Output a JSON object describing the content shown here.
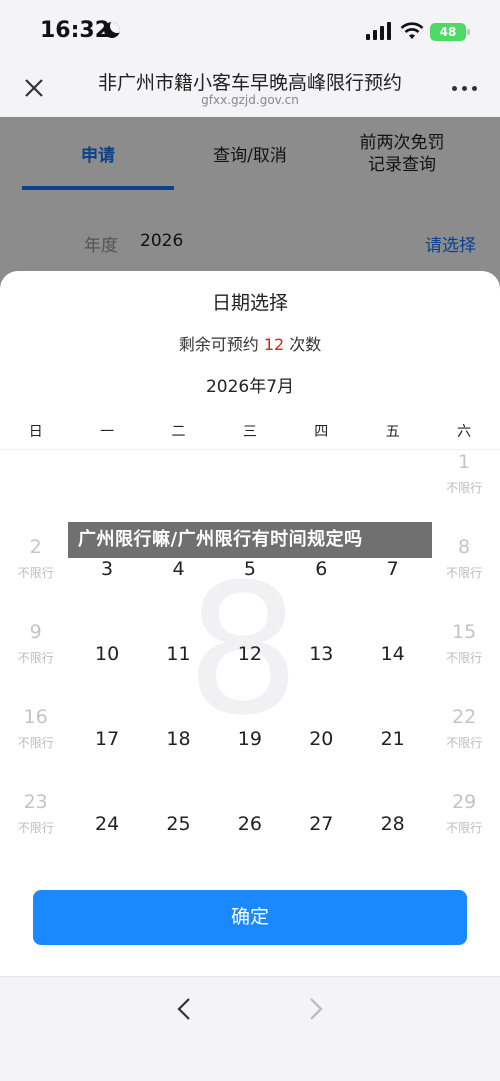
{
  "status_bar": {
    "time": "16:32",
    "battery": "48"
  },
  "header": {
    "title": "非广州市籍小客车早晚高峰限行预约",
    "url": "gfxx.gzjd.gov.cn"
  },
  "tabs": [
    {
      "label": "申请",
      "active": true
    },
    {
      "label": "查询/取消",
      "active": false
    },
    {
      "label": "前两次免罚\n记录查询",
      "active": false
    }
  ],
  "year_row": {
    "label": "年度",
    "value": "2026",
    "action": "请选择"
  },
  "sheet": {
    "title": "日期选择",
    "remaining_prefix": "剩余可预约",
    "remaining_count": "12",
    "remaining_suffix": "次数",
    "month": "2026年7月",
    "weekdays": [
      "日",
      "一",
      "二",
      "三",
      "四",
      "五",
      "六"
    ],
    "watermark": "8",
    "confirm_label": "确定",
    "days": [
      {
        "day": "1",
        "note": "不限行",
        "off": true
      },
      {
        "day": "2",
        "note": "不限行",
        "off": true
      },
      {
        "day": "3",
        "note": "",
        "off": false
      },
      {
        "day": "4",
        "note": "",
        "off": false
      },
      {
        "day": "5",
        "note": "",
        "off": false
      },
      {
        "day": "6",
        "note": "",
        "off": false
      },
      {
        "day": "7",
        "note": "",
        "off": false
      },
      {
        "day": "8",
        "note": "不限行",
        "off": true
      },
      {
        "day": "9",
        "note": "不限行",
        "off": true
      },
      {
        "day": "10",
        "note": "",
        "off": false
      },
      {
        "day": "11",
        "note": "",
        "off": false
      },
      {
        "day": "12",
        "note": "",
        "off": false
      },
      {
        "day": "13",
        "note": "",
        "off": false
      },
      {
        "day": "14",
        "note": "",
        "off": false
      },
      {
        "day": "15",
        "note": "不限行",
        "off": true
      },
      {
        "day": "16",
        "note": "不限行",
        "off": true
      },
      {
        "day": "17",
        "note": "",
        "off": false
      },
      {
        "day": "18",
        "note": "",
        "off": false
      },
      {
        "day": "19",
        "note": "",
        "off": false
      },
      {
        "day": "20",
        "note": "",
        "off": false
      },
      {
        "day": "21",
        "note": "",
        "off": false
      },
      {
        "day": "22",
        "note": "不限行",
        "off": true
      },
      {
        "day": "23",
        "note": "不限行",
        "off": true
      },
      {
        "day": "24",
        "note": "",
        "off": false
      },
      {
        "day": "25",
        "note": "",
        "off": false
      },
      {
        "day": "26",
        "note": "",
        "off": false
      },
      {
        "day": "27",
        "note": "",
        "off": false
      },
      {
        "day": "28",
        "note": "",
        "off": false
      },
      {
        "day": "29",
        "note": "不限行",
        "off": true
      }
    ]
  },
  "overlay_text": "广州限行嘛/广州限行有时间规定吗",
  "colors": {
    "accent": "#1677ff",
    "count": "#e02020",
    "battery": "#4cd964"
  }
}
